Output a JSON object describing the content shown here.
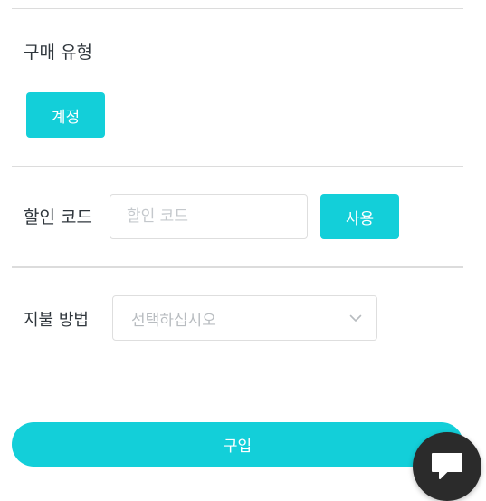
{
  "purchase_type": {
    "title": "구매 유형",
    "account_button": "계정"
  },
  "discount": {
    "label": "할인 코드",
    "input_placeholder": "할인 코드",
    "input_value": "",
    "apply_button": "사용"
  },
  "payment": {
    "label": "지불 방법",
    "select_placeholder": "선택하십시오"
  },
  "buy_button": "구입",
  "colors": {
    "accent": "#13cfd9",
    "chat_button": "#2b2b2b"
  },
  "icons": {
    "select_arrow": "chevron-down-icon",
    "chat": "chat-bubble-icon"
  }
}
